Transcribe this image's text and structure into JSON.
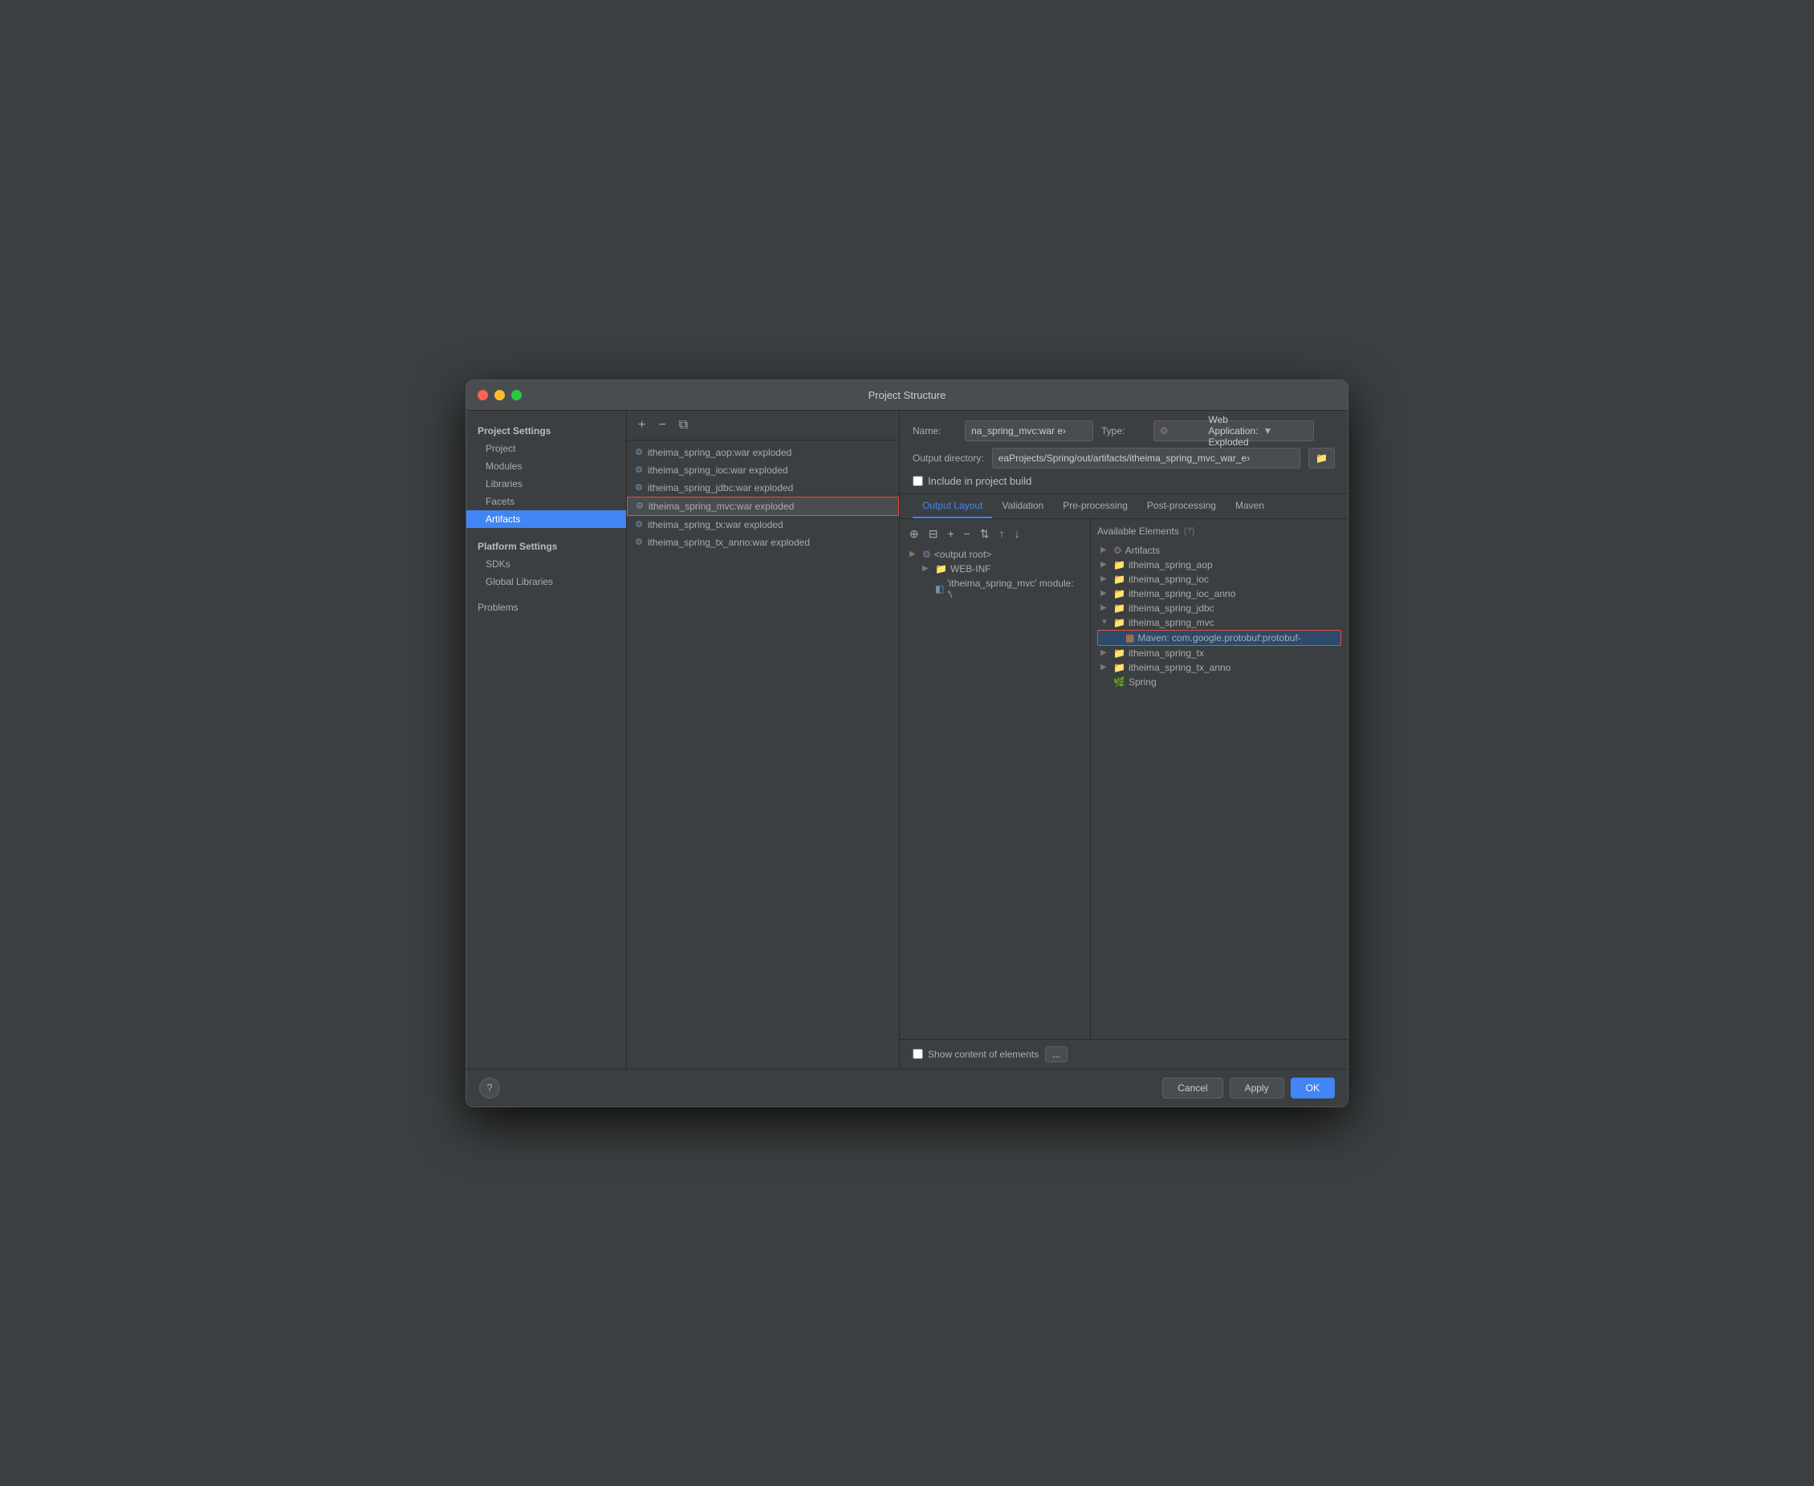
{
  "window": {
    "title": "Project Structure"
  },
  "sidebar": {
    "project_settings_label": "Project Settings",
    "items": [
      {
        "label": "Project",
        "active": false
      },
      {
        "label": "Modules",
        "active": false
      },
      {
        "label": "Libraries",
        "active": false
      },
      {
        "label": "Facets",
        "active": false
      },
      {
        "label": "Artifacts",
        "active": true
      }
    ],
    "platform_settings_label": "Platform Settings",
    "platform_items": [
      {
        "label": "SDKs",
        "active": false
      },
      {
        "label": "Global Libraries",
        "active": false
      }
    ],
    "problems_label": "Problems"
  },
  "middle": {
    "toolbar": {
      "add": "+",
      "remove": "−",
      "copy": "⧉"
    },
    "artifacts": [
      {
        "name": "itheima_spring_aop:war exploded",
        "selected": false
      },
      {
        "name": "itheima_spring_ioc:war exploded",
        "selected": false
      },
      {
        "name": "itheima_spring_jdbc:war exploded",
        "selected": false
      },
      {
        "name": "itheima_spring_mvc:war exploded",
        "selected": true
      },
      {
        "name": "itheima_spring_tx:war exploded",
        "selected": false
      },
      {
        "name": "itheima_spring_tx_anno:war exploded",
        "selected": false
      }
    ]
  },
  "right": {
    "name_label": "Name:",
    "name_value": "na_spring_mvc:war e›",
    "type_label": "Type:",
    "type_value": "Web Application: Exploded",
    "output_dir_label": "Output directory:",
    "output_dir_value": "eaProjects/Spring/out/artifacts/itheima_spring_mvc_war_e›",
    "include_label": "Include in project build",
    "tabs": [
      "Output Layout",
      "Validation",
      "Pre-processing",
      "Post-processing",
      "Maven"
    ],
    "active_tab": "Output Layout",
    "tree_items": [
      {
        "level": 0,
        "chevron": "▶",
        "icon": "⚙",
        "name": "<output root>",
        "icon_class": "artifact-gear"
      },
      {
        "level": 1,
        "chevron": "▶",
        "icon": "📁",
        "name": "WEB-INF",
        "icon_class": "folder-icon"
      },
      {
        "level": 1,
        "chevron": "",
        "icon": "◧",
        "name": "'itheima_spring_mvc' module: '\\",
        "icon_class": "module-icon"
      }
    ],
    "avail_label": "Available Elements",
    "avail_items": [
      {
        "level": 0,
        "chevron": "▶",
        "icon": "⚙",
        "name": "Artifacts",
        "icon_class": "artifact-gear"
      },
      {
        "level": 0,
        "chevron": "▶",
        "icon": "📁",
        "name": "itheima_spring_aop",
        "icon_class": "folder-icon"
      },
      {
        "level": 0,
        "chevron": "▶",
        "icon": "📁",
        "name": "itheima_spring_ioc",
        "icon_class": "folder-icon"
      },
      {
        "level": 0,
        "chevron": "▶",
        "icon": "📁",
        "name": "itheima_spring_ioc_anno",
        "icon_class": "folder-icon"
      },
      {
        "level": 0,
        "chevron": "▶",
        "icon": "📁",
        "name": "itheima_spring_jdbc",
        "icon_class": "folder-icon"
      },
      {
        "level": 0,
        "chevron": "▼",
        "icon": "📁",
        "name": "itheima_spring_mvc",
        "icon_class": "folder-icon",
        "expanded": true,
        "highlighted": false
      },
      {
        "level": 1,
        "chevron": "",
        "icon": "▦",
        "name": "Maven: com.google.protobuf:protobuf-",
        "icon_class": "maven-icon",
        "highlighted": true
      },
      {
        "level": 0,
        "chevron": "▶",
        "icon": "📁",
        "name": "itheima_spring_tx",
        "icon_class": "folder-icon"
      },
      {
        "level": 0,
        "chevron": "▶",
        "icon": "📁",
        "name": "itheima_spring_tx_anno",
        "icon_class": "folder-icon"
      },
      {
        "level": 0,
        "chevron": "",
        "icon": "🌿",
        "name": "Spring",
        "icon_class": "spring-icon"
      }
    ],
    "show_content_label": "Show content of elements",
    "ellipsis_label": "..."
  },
  "footer": {
    "cancel_label": "Cancel",
    "apply_label": "Apply",
    "ok_label": "OK",
    "help_label": "?"
  }
}
